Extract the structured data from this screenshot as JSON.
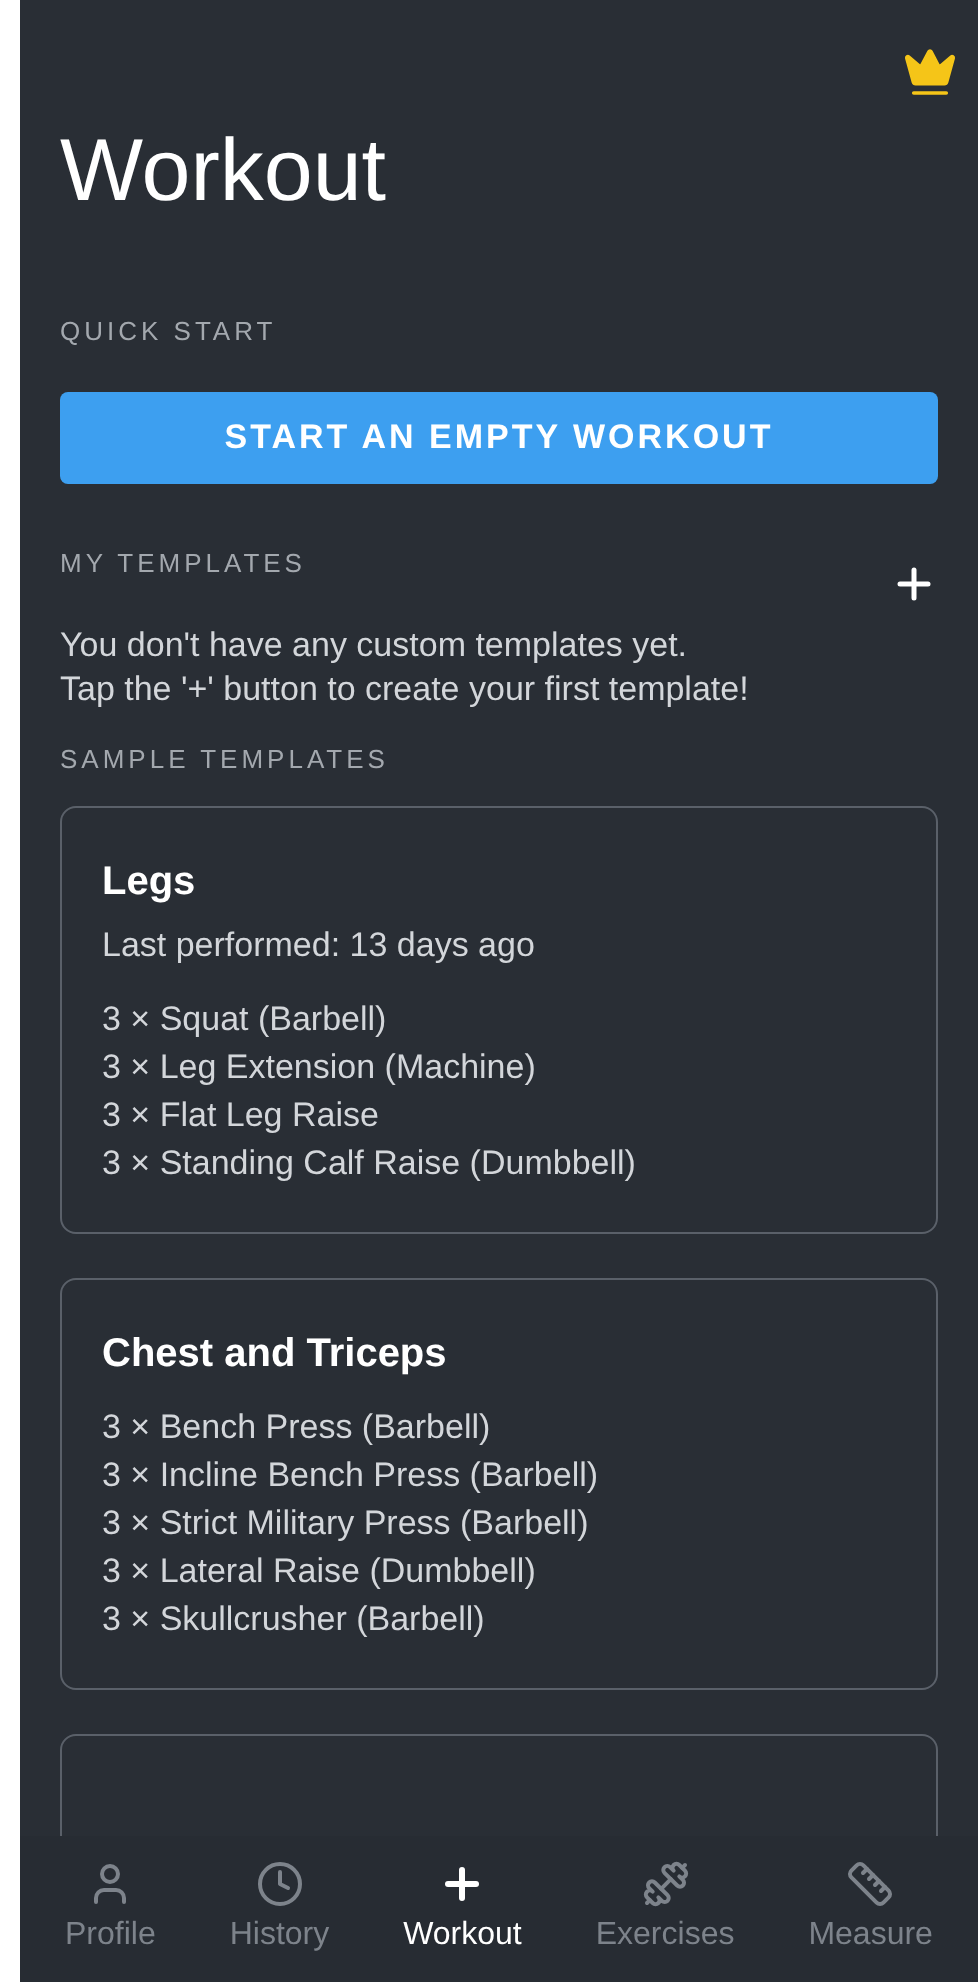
{
  "header": {
    "title": "Workout"
  },
  "quick_start": {
    "label": "QUICK START",
    "button": "START AN EMPTY WORKOUT"
  },
  "my_templates": {
    "label": "MY TEMPLATES",
    "empty_message": "You don't have any custom templates yet.\nTap the '+' button to create your first template!"
  },
  "sample_templates": {
    "label": "SAMPLE TEMPLATES",
    "cards": [
      {
        "title": "Legs",
        "last_performed": "Last performed: 13 days ago",
        "exercises": [
          "3 × Squat (Barbell)",
          "3 × Leg Extension (Machine)",
          "3 × Flat Leg Raise",
          "3 × Standing Calf Raise (Dumbbell)"
        ]
      },
      {
        "title": "Chest and Triceps",
        "exercises": [
          "3 × Bench Press (Barbell)",
          "3 × Incline Bench Press (Barbell)",
          "3 × Strict Military Press (Barbell)",
          "3 × Lateral Raise (Dumbbell)",
          "3 × Skullcrusher (Barbell)"
        ]
      }
    ]
  },
  "bottom_nav": [
    {
      "label": "Profile",
      "kind": "profile",
      "selected": false
    },
    {
      "label": "History",
      "kind": "history",
      "selected": false
    },
    {
      "label": "Workout",
      "kind": "workout",
      "selected": true
    },
    {
      "label": "Exercises",
      "kind": "exercises",
      "selected": false
    },
    {
      "label": "Measure",
      "kind": "measure",
      "selected": false
    }
  ]
}
